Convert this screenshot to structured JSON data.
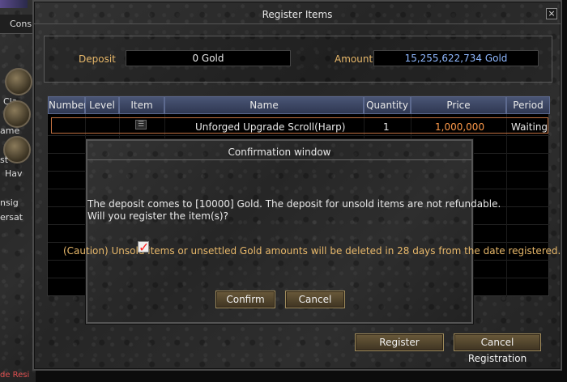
{
  "background": {
    "tab_label": "Cons",
    "side_texts": [
      "Cla",
      "ame",
      "st",
      "Hav",
      "nsig",
      "ersat"
    ],
    "bottom_text": "de Resi"
  },
  "window": {
    "title": "Register Items",
    "close_label": "×"
  },
  "deposit": {
    "label": "Deposit",
    "value": "0 Gold"
  },
  "amount": {
    "label": "Amount",
    "value": "15,255,622,734 Gold"
  },
  "table": {
    "headers": [
      "Number",
      "Level",
      "Item",
      "Name",
      "Quantity",
      "Price",
      "Period"
    ],
    "rows": [
      {
        "number": "",
        "level": "",
        "item_icon": "scroll-icon",
        "name": "Unforged Upgrade Scroll(Harp)",
        "quantity": "1",
        "price": "1,000,000",
        "period": "Waiting"
      }
    ]
  },
  "buttons": {
    "register": "Register",
    "cancel_registration": "Cancel Registration"
  },
  "confirm_dialog": {
    "title": "Confirmation window",
    "message_line1": "The deposit comes to [10000] Gold.  The deposit for unsold items are not refundable.",
    "message_line2": "Will you register the item(s)?",
    "caution": "(Caution) Unsold items or unsettled Gold amounts will be deleted in 28 days from the date registered.",
    "confirm_label": "Confirm",
    "cancel_label": "Cancel",
    "check_mark": "✓"
  },
  "colors": {
    "gold_label": "#e8b86a",
    "amount_value": "#8fb8ff",
    "price_value": "#ff9a4a",
    "header_bg": "#3a4560",
    "selected_border": "#c07040"
  }
}
